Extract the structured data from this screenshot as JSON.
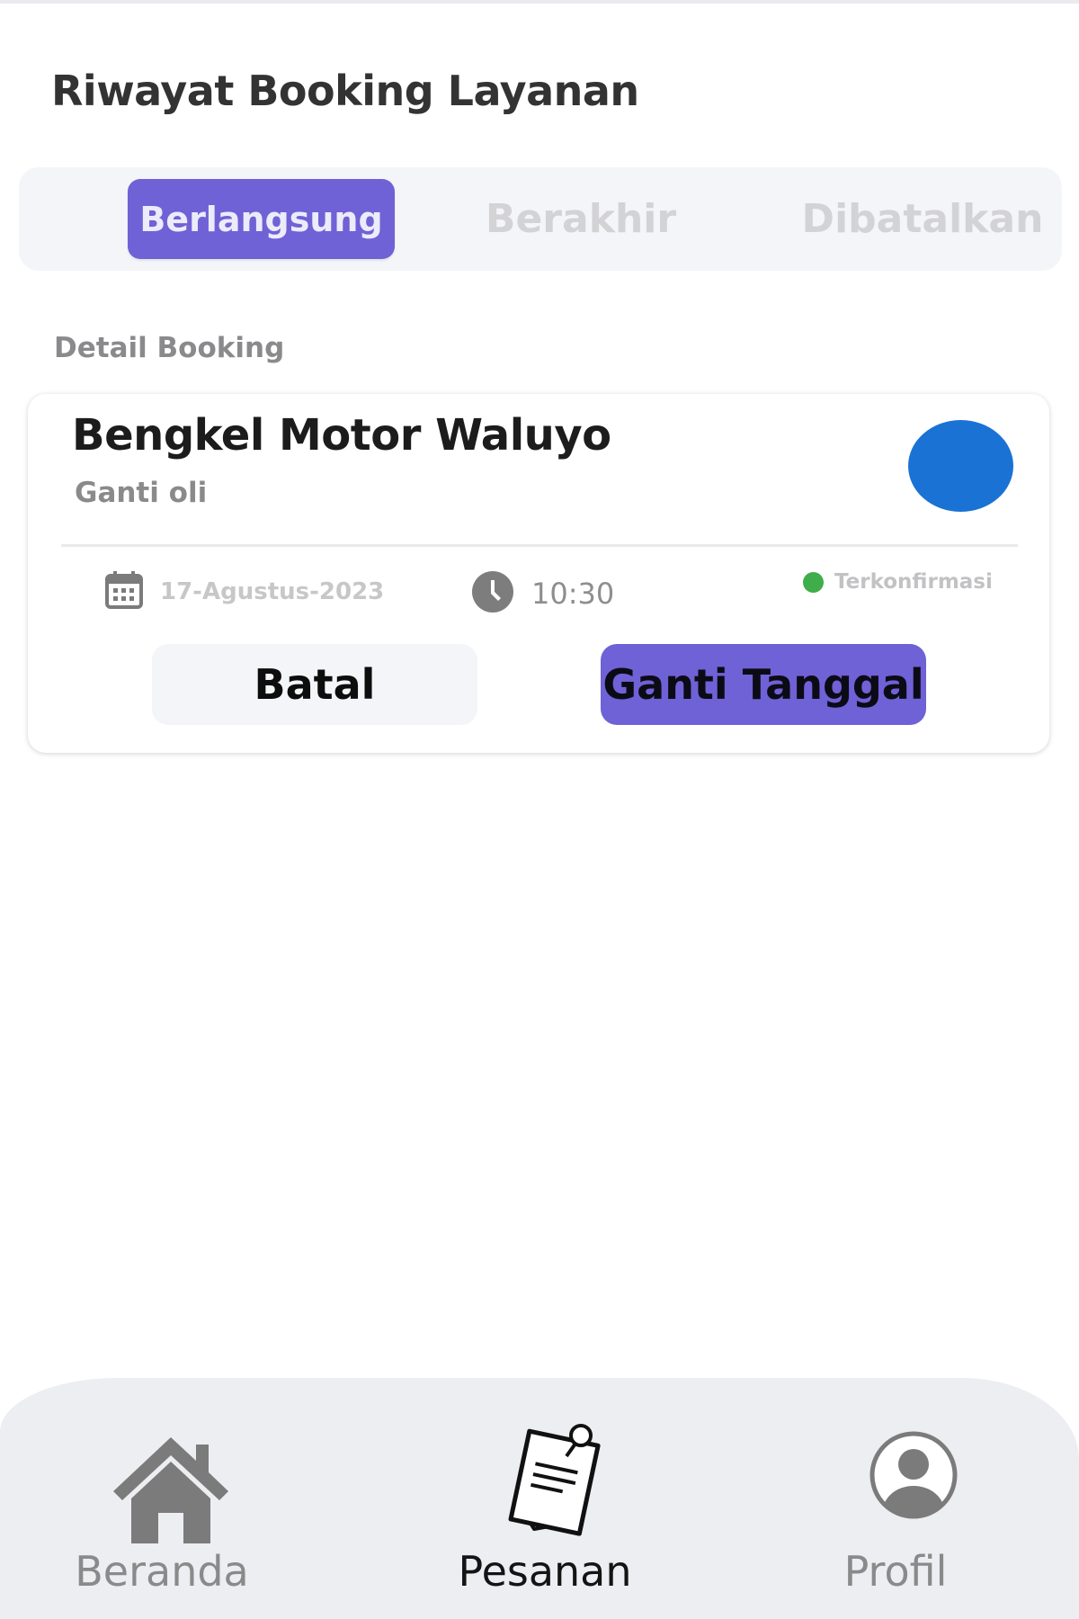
{
  "page": {
    "title": "Riwayat Booking Layanan",
    "section_label": "Detail Booking"
  },
  "tabs": [
    {
      "label": "Berlangsung",
      "active": true
    },
    {
      "label": "Berakhir",
      "active": false
    },
    {
      "label": "Dibatalkan",
      "active": false
    }
  ],
  "booking": {
    "shop_name": "Bengkel Motor Waluyo",
    "service": "Ganti oli",
    "date": "17-Agustus-2023",
    "time": "10:30",
    "status": "Terkonfirmasi",
    "cancel_label": "Batal",
    "reschedule_label": "Ganti Tanggal"
  },
  "bottom_nav": [
    {
      "label": "Beranda",
      "icon": "home-icon",
      "active": false
    },
    {
      "label": "Pesanan",
      "icon": "orders-icon",
      "active": true
    },
    {
      "label": "Profil",
      "icon": "profile-icon",
      "active": false
    }
  ],
  "colors": {
    "accent": "#6f61d6",
    "avatar": "#1a73d4",
    "status_confirmed": "#3fad4a",
    "tab_bg": "#f4f5f8",
    "nav_bg": "#eceef2"
  }
}
